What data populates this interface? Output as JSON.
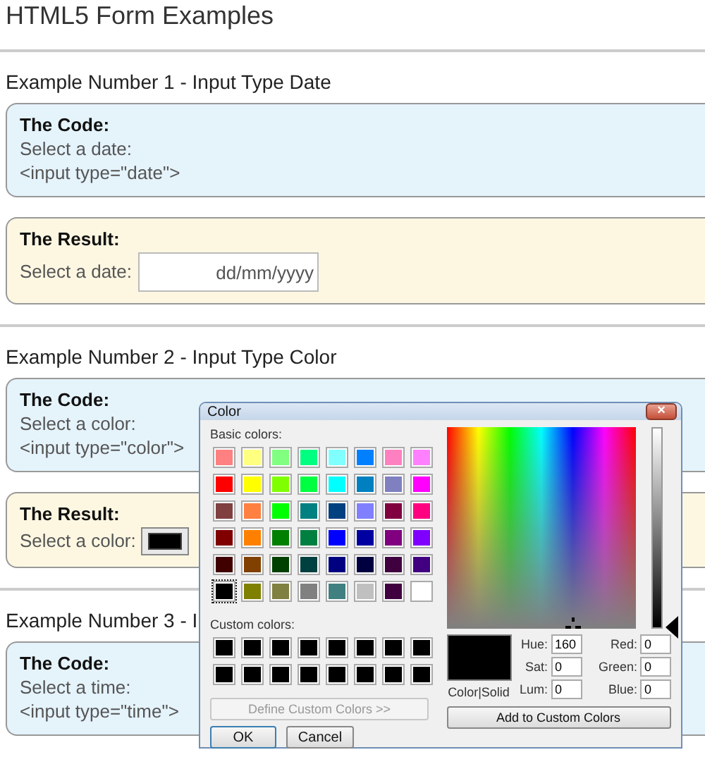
{
  "page": {
    "title": "HTML5 Form Examples",
    "examples": [
      {
        "heading": "Example Number 1 - Input Type Date",
        "code": {
          "label": "The Code:",
          "lines": [
            "Select a date:",
            "<input type=\"date\">"
          ]
        },
        "result": {
          "label": "The Result:",
          "field_label": "Select a date:",
          "kind": "date",
          "placeholder": "dd/mm/yyyy"
        }
      },
      {
        "heading": "Example Number 2 - Input Type Color",
        "code": {
          "label": "The Code:",
          "lines": [
            "Select a color:",
            "<input type=\"color\">"
          ]
        },
        "result": {
          "label": "The Result:",
          "field_label": "Select a color:",
          "kind": "color",
          "color": "#000000"
        }
      },
      {
        "heading": "Example Number 3 - I",
        "code": {
          "label": "The Code:",
          "lines": [
            "Select a time:",
            "<input type=\"time\">"
          ]
        }
      }
    ]
  },
  "dialog": {
    "title": "Color",
    "close": "×",
    "basic_label": "Basic colors:",
    "basic_colors": [
      {
        "color": "#ff8080",
        "selected": false
      },
      {
        "color": "#ffff80",
        "selected": false
      },
      {
        "color": "#80ff80",
        "selected": false
      },
      {
        "color": "#00ff80",
        "selected": false
      },
      {
        "color": "#80ffff",
        "selected": false
      },
      {
        "color": "#0080ff",
        "selected": false
      },
      {
        "color": "#ff80c0",
        "selected": false
      },
      {
        "color": "#ff80ff",
        "selected": false
      },
      {
        "color": "#ff0000",
        "selected": false
      },
      {
        "color": "#ffff00",
        "selected": false
      },
      {
        "color": "#80ff00",
        "selected": false
      },
      {
        "color": "#00ff40",
        "selected": false
      },
      {
        "color": "#00ffff",
        "selected": false
      },
      {
        "color": "#0080c0",
        "selected": false
      },
      {
        "color": "#8080c0",
        "selected": false
      },
      {
        "color": "#ff00ff",
        "selected": false
      },
      {
        "color": "#804040",
        "selected": false
      },
      {
        "color": "#ff8040",
        "selected": false
      },
      {
        "color": "#00ff00",
        "selected": false
      },
      {
        "color": "#008080",
        "selected": false
      },
      {
        "color": "#004080",
        "selected": false
      },
      {
        "color": "#8080ff",
        "selected": false
      },
      {
        "color": "#800040",
        "selected": false
      },
      {
        "color": "#ff0080",
        "selected": false
      },
      {
        "color": "#800000",
        "selected": false
      },
      {
        "color": "#ff8000",
        "selected": false
      },
      {
        "color": "#008000",
        "selected": false
      },
      {
        "color": "#008040",
        "selected": false
      },
      {
        "color": "#0000ff",
        "selected": false
      },
      {
        "color": "#0000a0",
        "selected": false
      },
      {
        "color": "#800080",
        "selected": false
      },
      {
        "color": "#8000ff",
        "selected": false
      },
      {
        "color": "#400000",
        "selected": false
      },
      {
        "color": "#804000",
        "selected": false
      },
      {
        "color": "#004000",
        "selected": false
      },
      {
        "color": "#004040",
        "selected": false
      },
      {
        "color": "#000080",
        "selected": false
      },
      {
        "color": "#000040",
        "selected": false
      },
      {
        "color": "#400040",
        "selected": false
      },
      {
        "color": "#400080",
        "selected": false
      },
      {
        "color": "#000000",
        "selected": true
      },
      {
        "color": "#808000",
        "selected": false
      },
      {
        "color": "#808040",
        "selected": false
      },
      {
        "color": "#808080",
        "selected": false
      },
      {
        "color": "#408080",
        "selected": false
      },
      {
        "color": "#c0c0c0",
        "selected": false
      },
      {
        "color": "#400040",
        "selected": false
      },
      {
        "color": "#ffffff",
        "selected": false
      }
    ],
    "custom_label": "Custom colors:",
    "custom_colors": [
      {
        "color": "#000000"
      },
      {
        "color": "#000000"
      },
      {
        "color": "#000000"
      },
      {
        "color": "#000000"
      },
      {
        "color": "#000000"
      },
      {
        "color": "#000000"
      },
      {
        "color": "#000000"
      },
      {
        "color": "#000000"
      },
      {
        "color": "#000000"
      },
      {
        "color": "#000000"
      },
      {
        "color": "#000000"
      },
      {
        "color": "#000000"
      },
      {
        "color": "#000000"
      },
      {
        "color": "#000000"
      },
      {
        "color": "#000000"
      },
      {
        "color": "#000000"
      }
    ],
    "define_button": {
      "label": "Define Custom Colors >>",
      "disabled": true
    },
    "ok_button": "OK",
    "cancel_button": "Cancel",
    "luminance": {
      "level": 0
    },
    "preview": {
      "color": "#000000",
      "label": "Color|Solid"
    },
    "fields_left": [
      {
        "label": "Hue:",
        "value": "160"
      },
      {
        "label": "Sat:",
        "value": "0"
      },
      {
        "label": "Lum:",
        "value": "0"
      }
    ],
    "fields_right": [
      {
        "label": "Red:",
        "value": "0"
      },
      {
        "label": "Green:",
        "value": "0"
      },
      {
        "label": "Blue:",
        "value": "0"
      }
    ],
    "add_button": "Add to Custom Colors"
  }
}
